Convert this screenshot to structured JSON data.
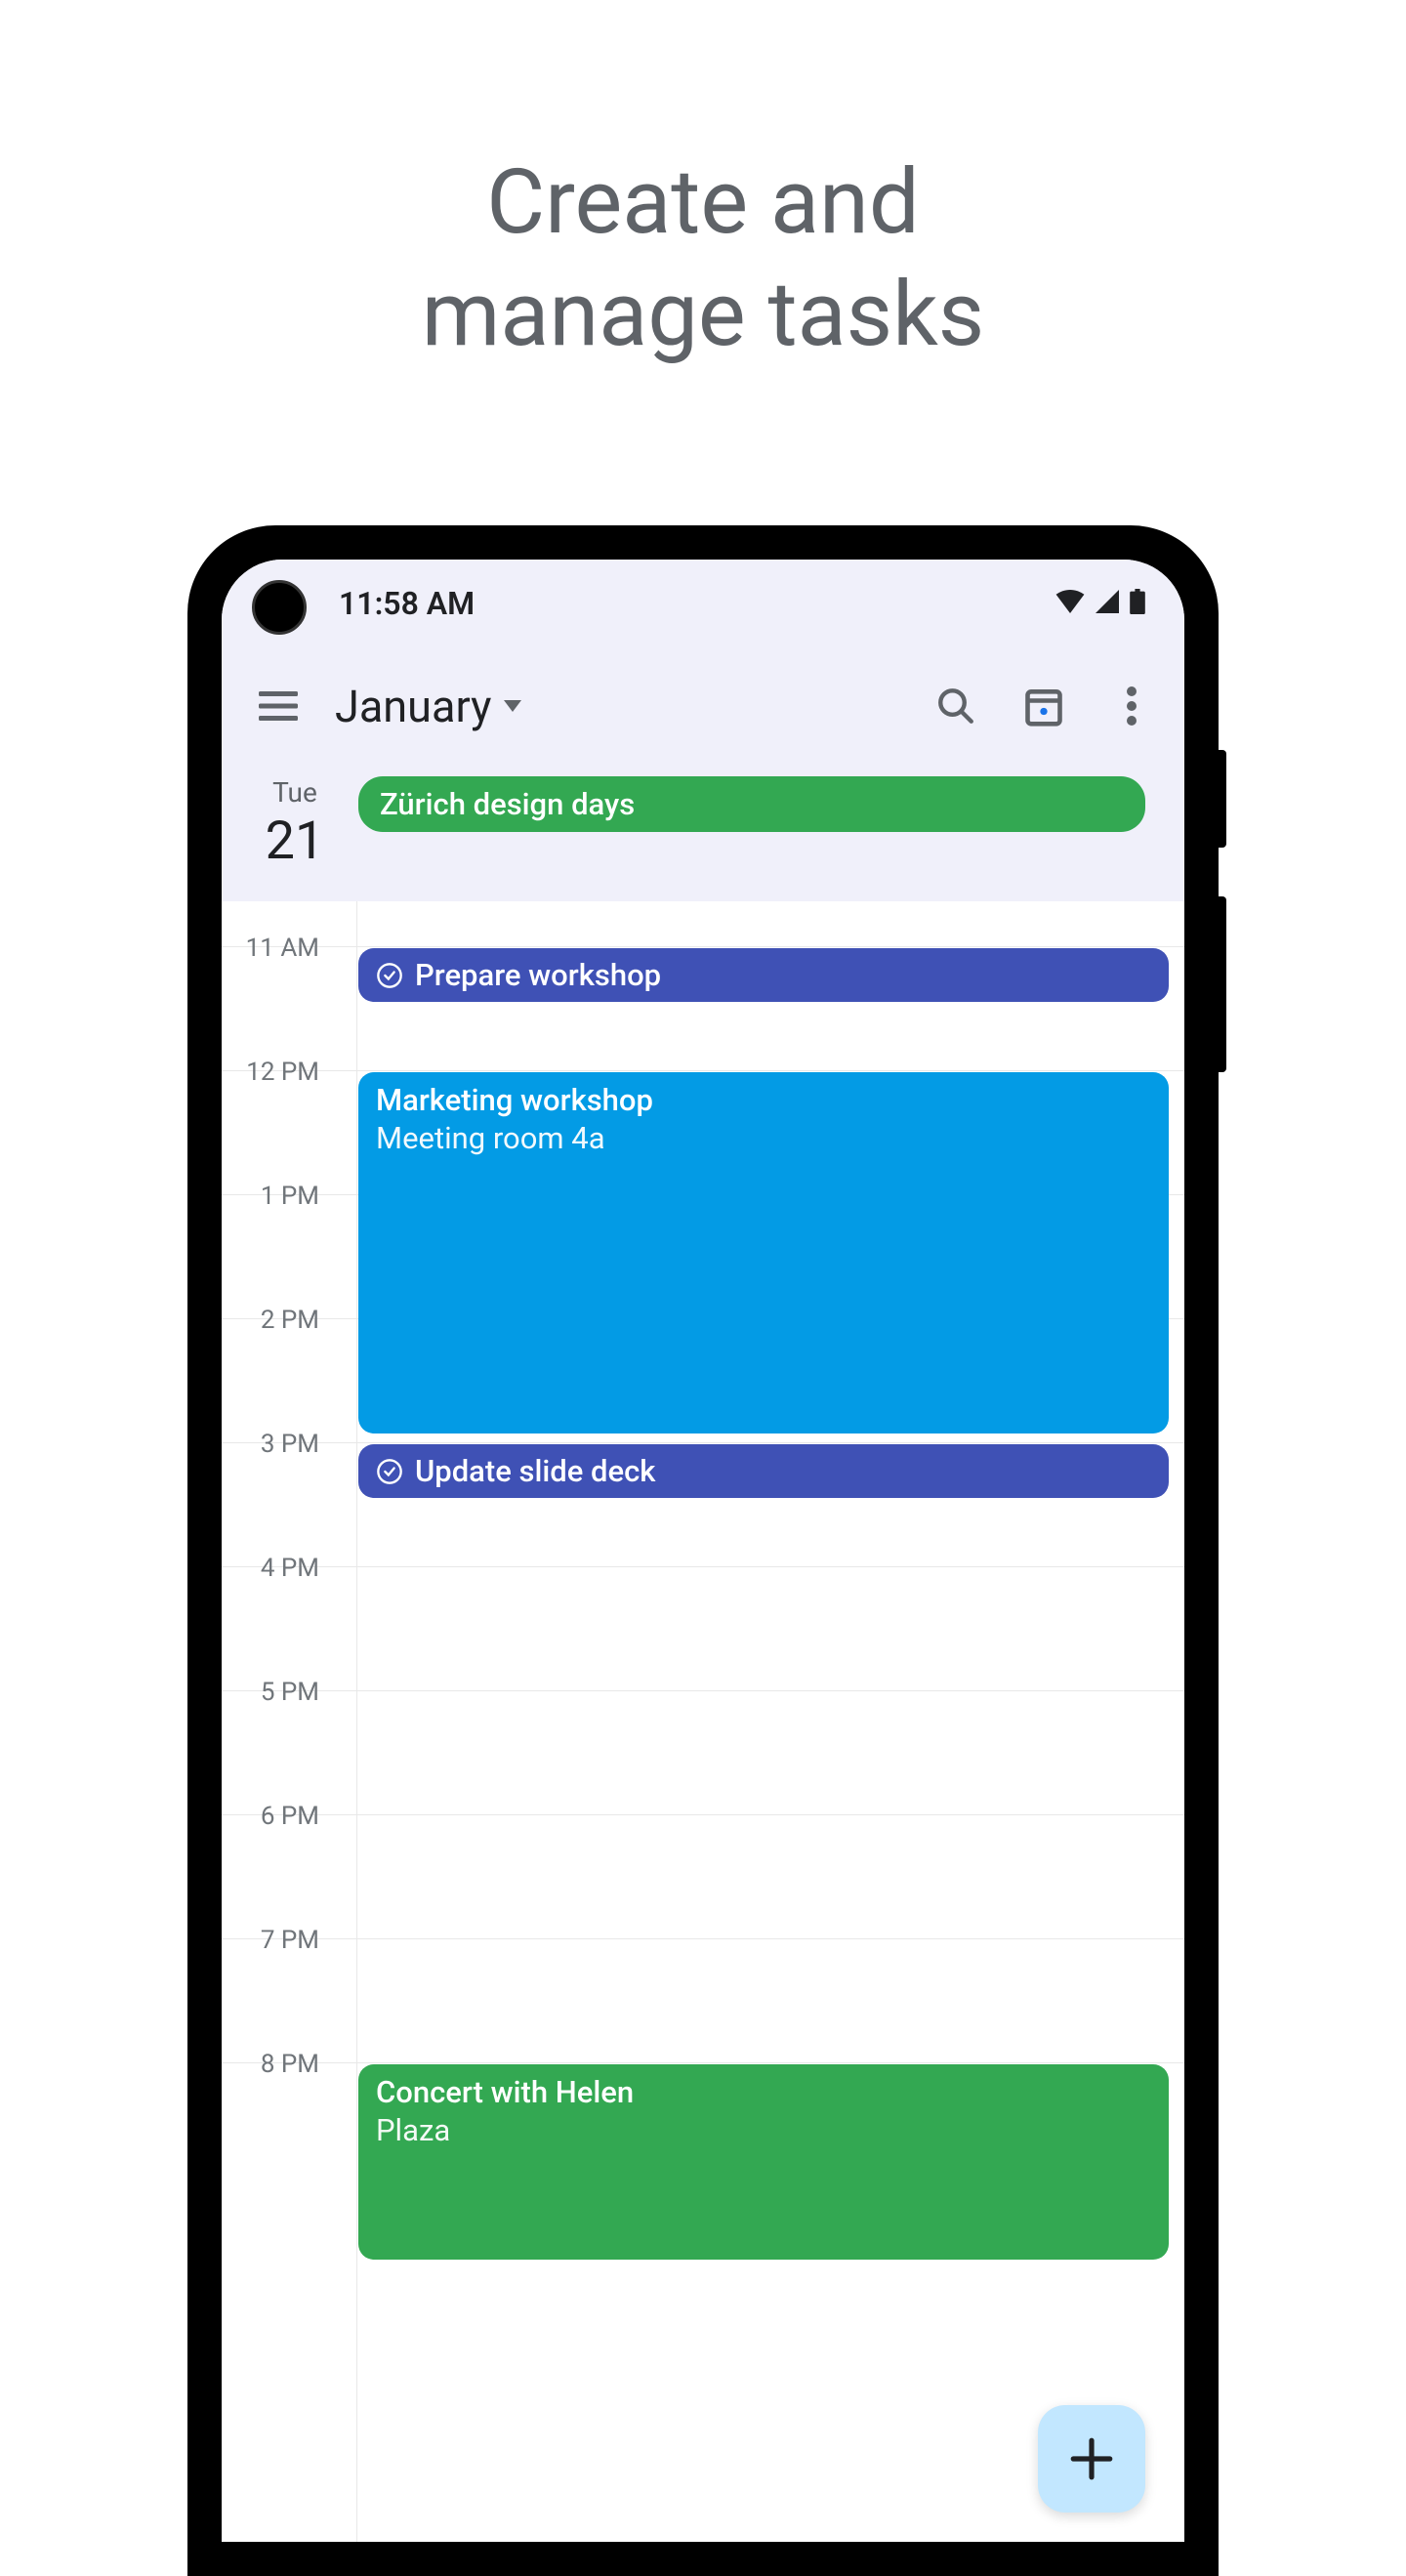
{
  "page": {
    "title_line1": "Create and",
    "title_line2": "manage tasks"
  },
  "status_bar": {
    "time": "11:58 AM"
  },
  "toolbar": {
    "month": "January"
  },
  "day_header": {
    "weekday": "Tue",
    "day_number": "21",
    "allday_event": "Zürich design days"
  },
  "hours": {
    "h11": "11 AM",
    "h12": "12 PM",
    "h13": "1 PM",
    "h14": "2 PM",
    "h15": "3 PM",
    "h16": "4 PM",
    "h17": "5 PM",
    "h18": "6 PM",
    "h19": "7 PM",
    "h20": "8 PM"
  },
  "events": {
    "task1": {
      "title": "Prepare workshop"
    },
    "meeting": {
      "title": "Marketing workshop",
      "location": "Meeting room 4a"
    },
    "task2": {
      "title": "Update slide deck"
    },
    "concert": {
      "title": "Concert with Helen",
      "location": "Plaza"
    }
  },
  "colors": {
    "green": "#33a852",
    "blue": "#039be5",
    "indigo": "#3f51b5",
    "fab": "#c2e7ff"
  }
}
